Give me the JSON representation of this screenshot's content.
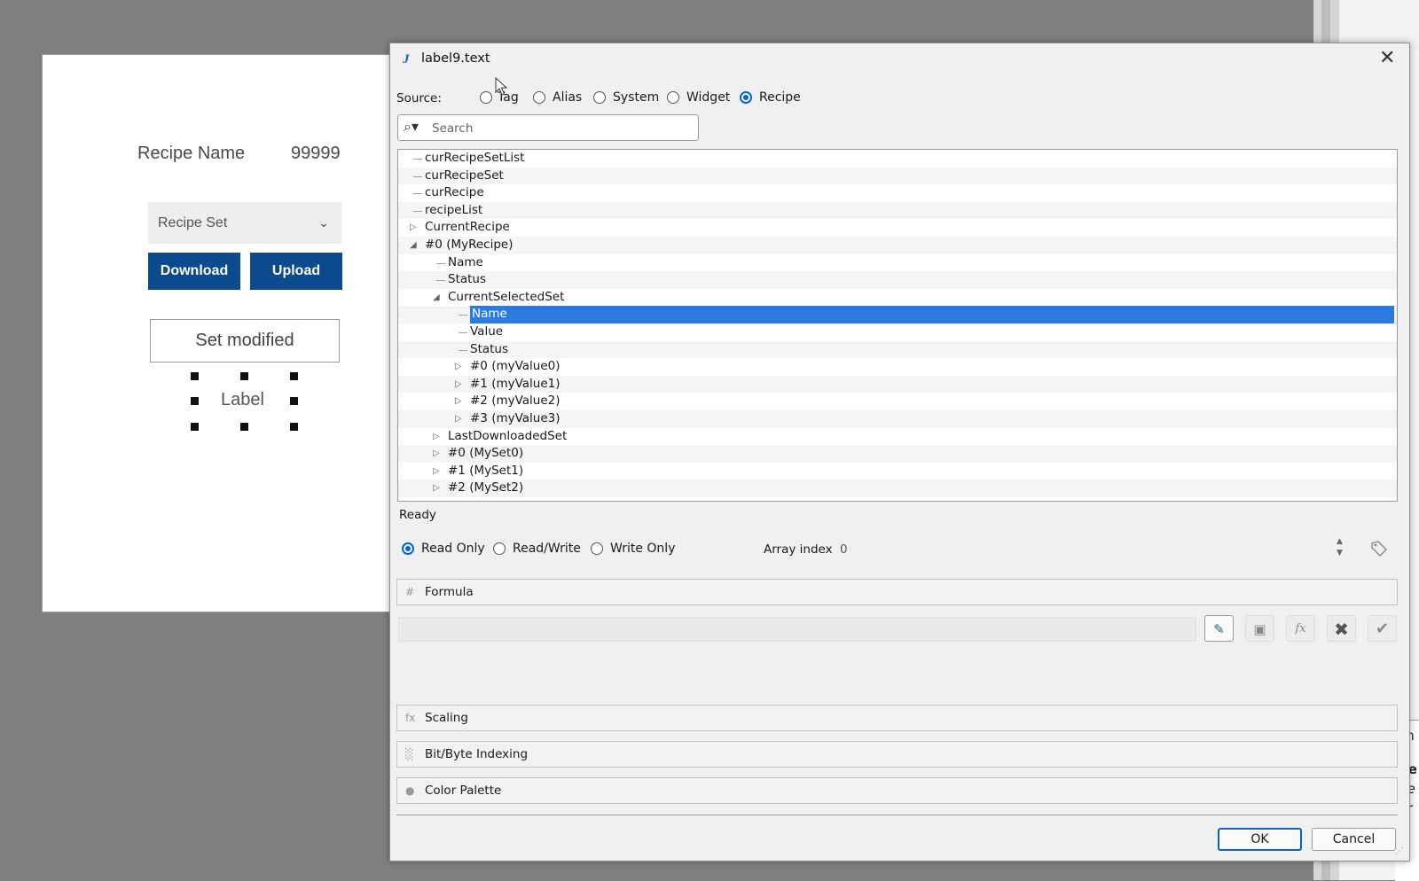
{
  "canvas": {
    "recipe_name_label": "Recipe Name",
    "recipe_name_value": "99999",
    "recipe_set_dropdown": "Recipe Set",
    "download_label": "Download",
    "upload_label": "Upload",
    "set_modified_label": "Set modified",
    "label_widget_text": "Label"
  },
  "dialog": {
    "title": "label9.text",
    "source_label": "Source:",
    "sources": [
      "Tag",
      "Alias",
      "System",
      "Widget",
      "Recipe"
    ],
    "selected_source": "Recipe",
    "search_placeholder": "Search",
    "tree": [
      {
        "label": "curRecipeSetList",
        "depth": 0,
        "expander": "none"
      },
      {
        "label": "curRecipeSet",
        "depth": 0,
        "expander": "none"
      },
      {
        "label": "curRecipe",
        "depth": 0,
        "expander": "none"
      },
      {
        "label": "recipeList",
        "depth": 0,
        "expander": "none"
      },
      {
        "label": "CurrentRecipe",
        "depth": 0,
        "expander": "collapsed"
      },
      {
        "label": "#0 (MyRecipe)",
        "depth": 0,
        "expander": "expanded"
      },
      {
        "label": "Name",
        "depth": 1,
        "expander": "none"
      },
      {
        "label": "Status",
        "depth": 1,
        "expander": "none"
      },
      {
        "label": "CurrentSelectedSet",
        "depth": 1,
        "expander": "expanded"
      },
      {
        "label": "Name",
        "depth": 2,
        "expander": "none",
        "selected": true
      },
      {
        "label": "Value",
        "depth": 2,
        "expander": "none"
      },
      {
        "label": "Status",
        "depth": 2,
        "expander": "none"
      },
      {
        "label": "#0 (myValue0)",
        "depth": 2,
        "expander": "collapsed"
      },
      {
        "label": "#1 (myValue1)",
        "depth": 2,
        "expander": "collapsed"
      },
      {
        "label": "#2 (myValue2)",
        "depth": 2,
        "expander": "collapsed"
      },
      {
        "label": "#3 (myValue3)",
        "depth": 2,
        "expander": "collapsed"
      },
      {
        "label": "LastDownloadedSet",
        "depth": 1,
        "expander": "collapsed"
      },
      {
        "label": "#0 (MySet0)",
        "depth": 1,
        "expander": "collapsed"
      },
      {
        "label": "#1 (MySet1)",
        "depth": 1,
        "expander": "collapsed"
      },
      {
        "label": "#2 (MySet2)",
        "depth": 1,
        "expander": "collapsed"
      }
    ],
    "status": "Ready",
    "access_modes": [
      "Read Only",
      "Read/Write",
      "Write Only"
    ],
    "selected_access": "Read Only",
    "array_index_label": "Array index",
    "array_index_value": "0",
    "formula_label": "Formula",
    "scaling_label": "Scaling",
    "bitbyte_label": "Bit/Byte Indexing",
    "palette_label": "Color Palette",
    "ok_label": "OK",
    "cancel_label": "Cancel"
  },
  "background_panel": {
    "text_fragments": [
      "ch",
      "pe",
      "ge",
      "er"
    ]
  },
  "colors": {
    "accent": "#0064d2",
    "selection": "#2b7ae0",
    "brand_button": "#0b4a8c"
  }
}
